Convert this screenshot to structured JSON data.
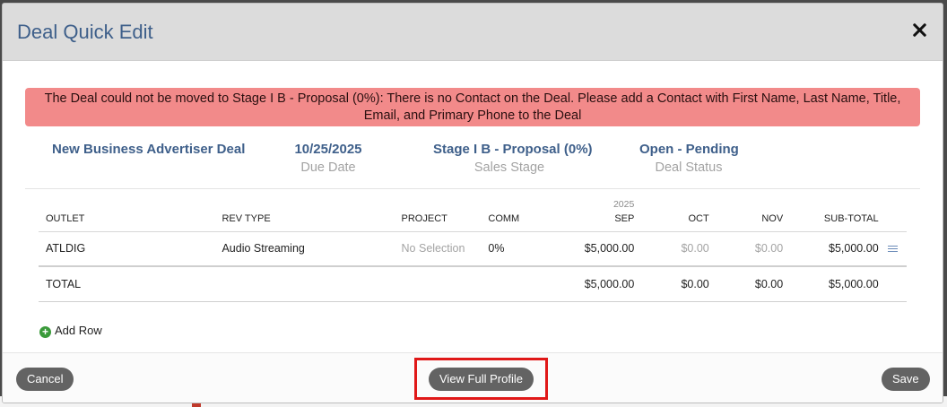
{
  "modal": {
    "title": "Deal Quick Edit",
    "error": "The Deal could not be moved to Stage I B - Proposal (0%): There is no Contact on the Deal. Please add a Contact with First Name, Last Name, Title, Email, and Primary Phone to the Deal"
  },
  "summary": {
    "deal_name": "New Business Advertiser Deal",
    "due_date": "10/25/2025",
    "due_date_label": "Due Date",
    "stage": "Stage I B - Proposal (0%)",
    "stage_label": "Sales Stage",
    "status": "Open - Pending",
    "status_label": "Deal Status"
  },
  "table": {
    "headers": {
      "outlet": "OUTLET",
      "rev_type": "REV TYPE",
      "project": "PROJECT",
      "comm": "COMM",
      "year": "2025",
      "sep": "SEP",
      "oct": "OCT",
      "nov": "NOV",
      "subtotal": "SUB-TOTAL"
    },
    "row": {
      "outlet": "ATLDIG",
      "rev_type": "Audio Streaming",
      "project": "No Selection",
      "comm": "0%",
      "sep": "$5,000.00",
      "oct": "$0.00",
      "nov": "$0.00",
      "subtotal": "$5,000.00",
      "icon": "list-icon"
    },
    "total": {
      "label": "TOTAL",
      "sep": "$5,000.00",
      "oct": "$0.00",
      "nov": "$0.00",
      "subtotal": "$5,000.00"
    }
  },
  "add_row_label": "Add Row",
  "footer": {
    "cancel": "Cancel",
    "view_profile": "View Full Profile",
    "save": "Save"
  },
  "colors": {
    "title_blue": "#3e5f8a",
    "error_bg": "#f28a8a",
    "button_bg": "#636363",
    "highlight": "#e01818",
    "add_green": "#3a9a3a"
  }
}
